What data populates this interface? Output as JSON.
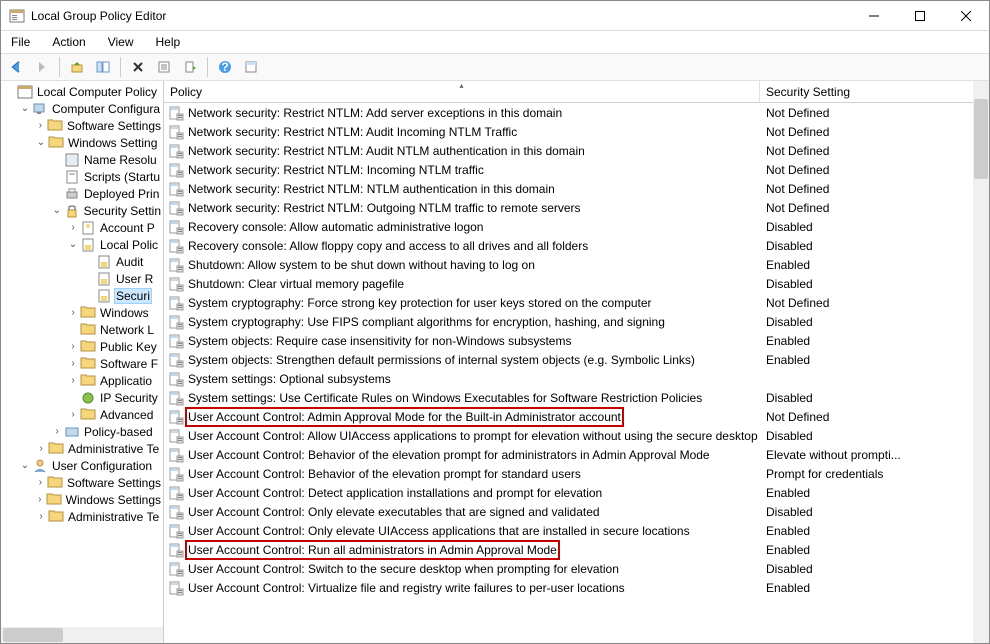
{
  "window": {
    "title": "Local Group Policy Editor"
  },
  "menu": {
    "file": "File",
    "action": "Action",
    "view": "View",
    "help": "Help"
  },
  "tree": {
    "root": "Local Computer Policy",
    "cc": "Computer Configura",
    "cc_ss": "Software Settings",
    "cc_ws": "Windows Setting",
    "nr": "Name Resolu",
    "scripts": "Scripts (Startu",
    "dp": "Deployed Prin",
    "sec": "Security Settin",
    "ap": "Account P",
    "lp": "Local Polic",
    "audit": "Audit",
    "userr": "User R",
    "securi": "Securi",
    "wf": "Windows",
    "nl": "Network L",
    "pk": "Public Key",
    "srp": "Software F",
    "acp": "Applicatio",
    "ips": "IP Security",
    "adv": "Advanced",
    "pb": "Policy-based",
    "at": "Administrative Te",
    "uc": "User Configuration",
    "uc_ss": "Software Settings",
    "uc_ws": "Windows Settings",
    "uc_at": "Administrative Te"
  },
  "columns": {
    "policy": "Policy",
    "setting": "Security Setting"
  },
  "policies": [
    {
      "name": "Network security: Restrict NTLM: Add server exceptions in this domain",
      "setting": "Not Defined"
    },
    {
      "name": "Network security: Restrict NTLM: Audit Incoming NTLM Traffic",
      "setting": "Not Defined"
    },
    {
      "name": "Network security: Restrict NTLM: Audit NTLM authentication in this domain",
      "setting": "Not Defined"
    },
    {
      "name": "Network security: Restrict NTLM: Incoming NTLM traffic",
      "setting": "Not Defined"
    },
    {
      "name": "Network security: Restrict NTLM: NTLM authentication in this domain",
      "setting": "Not Defined"
    },
    {
      "name": "Network security: Restrict NTLM: Outgoing NTLM traffic to remote servers",
      "setting": "Not Defined"
    },
    {
      "name": "Recovery console: Allow automatic administrative logon",
      "setting": "Disabled"
    },
    {
      "name": "Recovery console: Allow floppy copy and access to all drives and all folders",
      "setting": "Disabled"
    },
    {
      "name": "Shutdown: Allow system to be shut down without having to log on",
      "setting": "Enabled"
    },
    {
      "name": "Shutdown: Clear virtual memory pagefile",
      "setting": "Disabled"
    },
    {
      "name": "System cryptography: Force strong key protection for user keys stored on the computer",
      "setting": "Not Defined"
    },
    {
      "name": "System cryptography: Use FIPS compliant algorithms for encryption, hashing, and signing",
      "setting": "Disabled"
    },
    {
      "name": "System objects: Require case insensitivity for non-Windows subsystems",
      "setting": "Enabled"
    },
    {
      "name": "System objects: Strengthen default permissions of internal system objects (e.g. Symbolic Links)",
      "setting": "Enabled"
    },
    {
      "name": "System settings: Optional subsystems",
      "setting": ""
    },
    {
      "name": "System settings: Use Certificate Rules on Windows Executables for Software Restriction Policies",
      "setting": "Disabled"
    },
    {
      "name": "User Account Control: Admin Approval Mode for the Built-in Administrator account",
      "setting": "Not Defined",
      "hl": true
    },
    {
      "name": "User Account Control: Allow UIAccess applications to prompt for elevation without using the secure desktop",
      "setting": "Disabled"
    },
    {
      "name": "User Account Control: Behavior of the elevation prompt for administrators in Admin Approval Mode",
      "setting": "Elevate without prompti..."
    },
    {
      "name": "User Account Control: Behavior of the elevation prompt for standard users",
      "setting": "Prompt for credentials"
    },
    {
      "name": "User Account Control: Detect application installations and prompt for elevation",
      "setting": "Enabled"
    },
    {
      "name": "User Account Control: Only elevate executables that are signed and validated",
      "setting": "Disabled"
    },
    {
      "name": "User Account Control: Only elevate UIAccess applications that are installed in secure locations",
      "setting": "Enabled"
    },
    {
      "name": "User Account Control: Run all administrators in Admin Approval Mode",
      "setting": "Enabled",
      "hl": true
    },
    {
      "name": "User Account Control: Switch to the secure desktop when prompting for elevation",
      "setting": "Disabled"
    },
    {
      "name": "User Account Control: Virtualize file and registry write failures to per-user locations",
      "setting": "Enabled"
    }
  ]
}
